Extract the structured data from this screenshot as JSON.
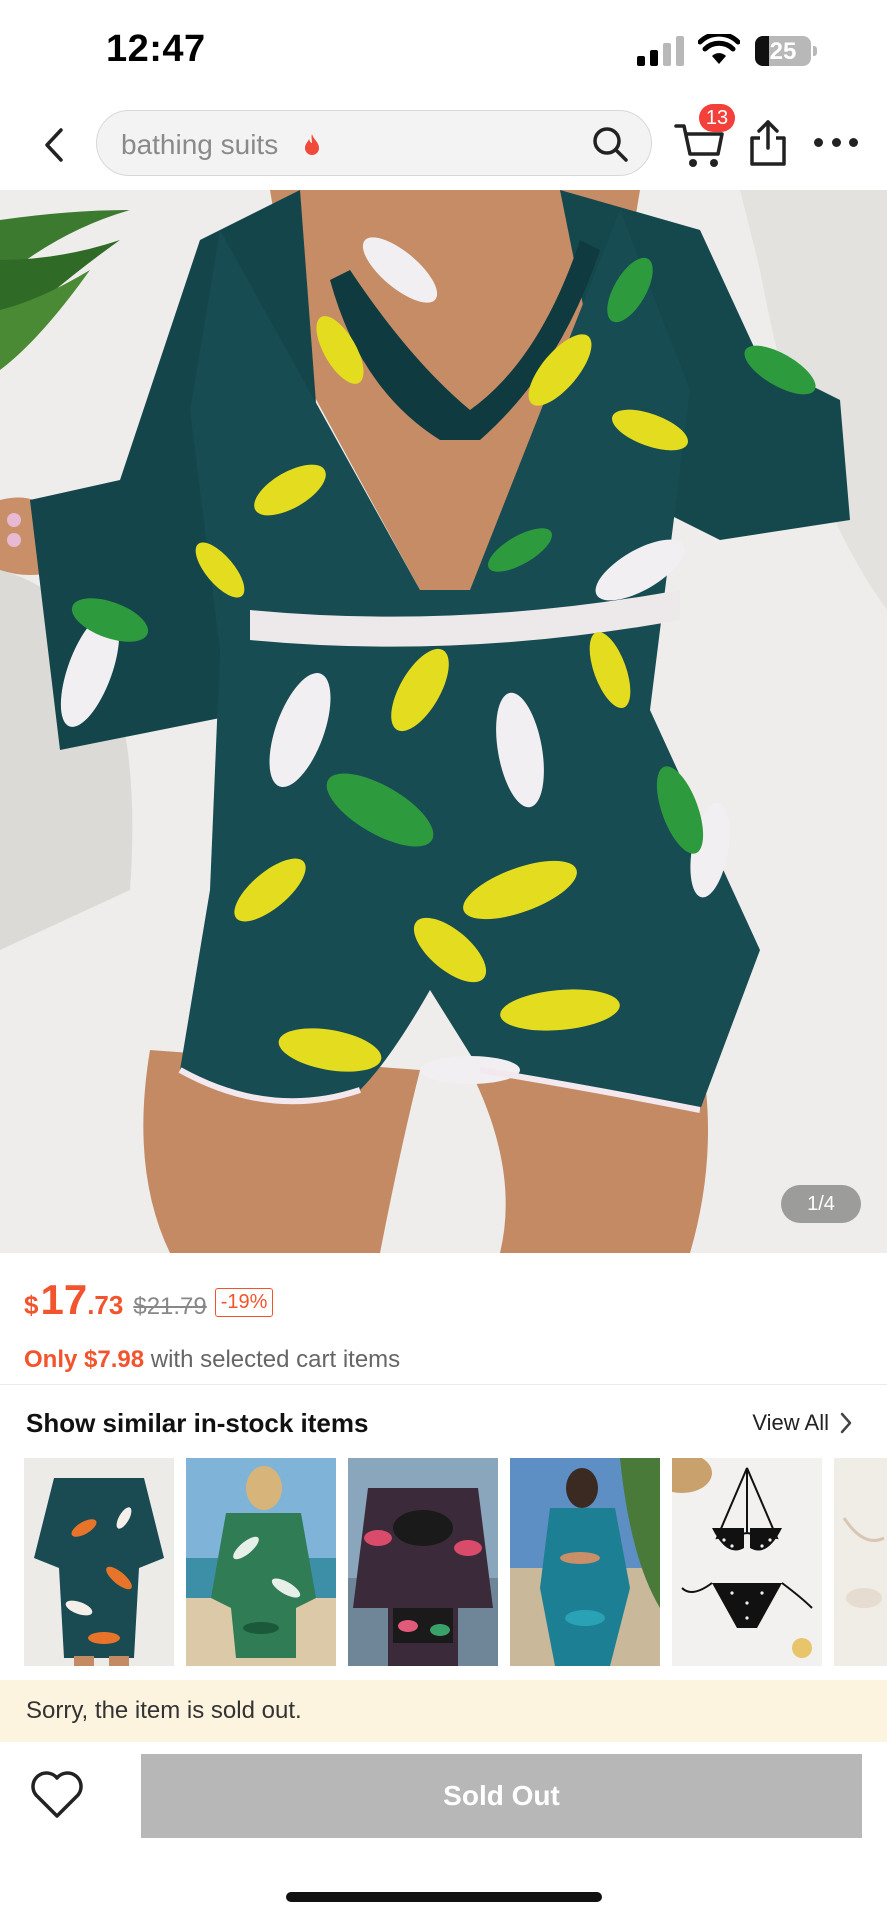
{
  "status_bar": {
    "time": "12:47",
    "battery_level": "25",
    "battery_fraction": 0.25,
    "icons": [
      "signal-icon",
      "wifi-icon",
      "battery-icon"
    ]
  },
  "nav": {
    "back_icon": "chevron-left-icon",
    "search_placeholder": "bathing suits",
    "search_trend_icon": "flame-icon",
    "search_icon": "search-icon",
    "cart_icon": "cart-icon",
    "cart_count": "13",
    "share_icon": "share-icon",
    "more_icon": "more-dots-icon"
  },
  "hero": {
    "image_counter": "1/4"
  },
  "price": {
    "currency": "$",
    "integer": "17",
    "decimal": ".73",
    "original": "$21.79",
    "discount": "-19%"
  },
  "promo": {
    "accent": "Only $7.98",
    "rest": " with selected cart items"
  },
  "similar": {
    "title": "Show similar in-stock items",
    "view_all": "View All",
    "view_all_icon": "chevron-right-icon"
  },
  "notice": {
    "text": "Sorry, the item is sold out."
  },
  "bottom": {
    "wishlist_icon": "heart-icon",
    "button_label": "Sold Out"
  },
  "colors": {
    "price_accent": "#f2542d",
    "badge_red": "#f4403a",
    "disabled_button": "#b7b7b7",
    "notice_bg": "#fdf4e0"
  }
}
